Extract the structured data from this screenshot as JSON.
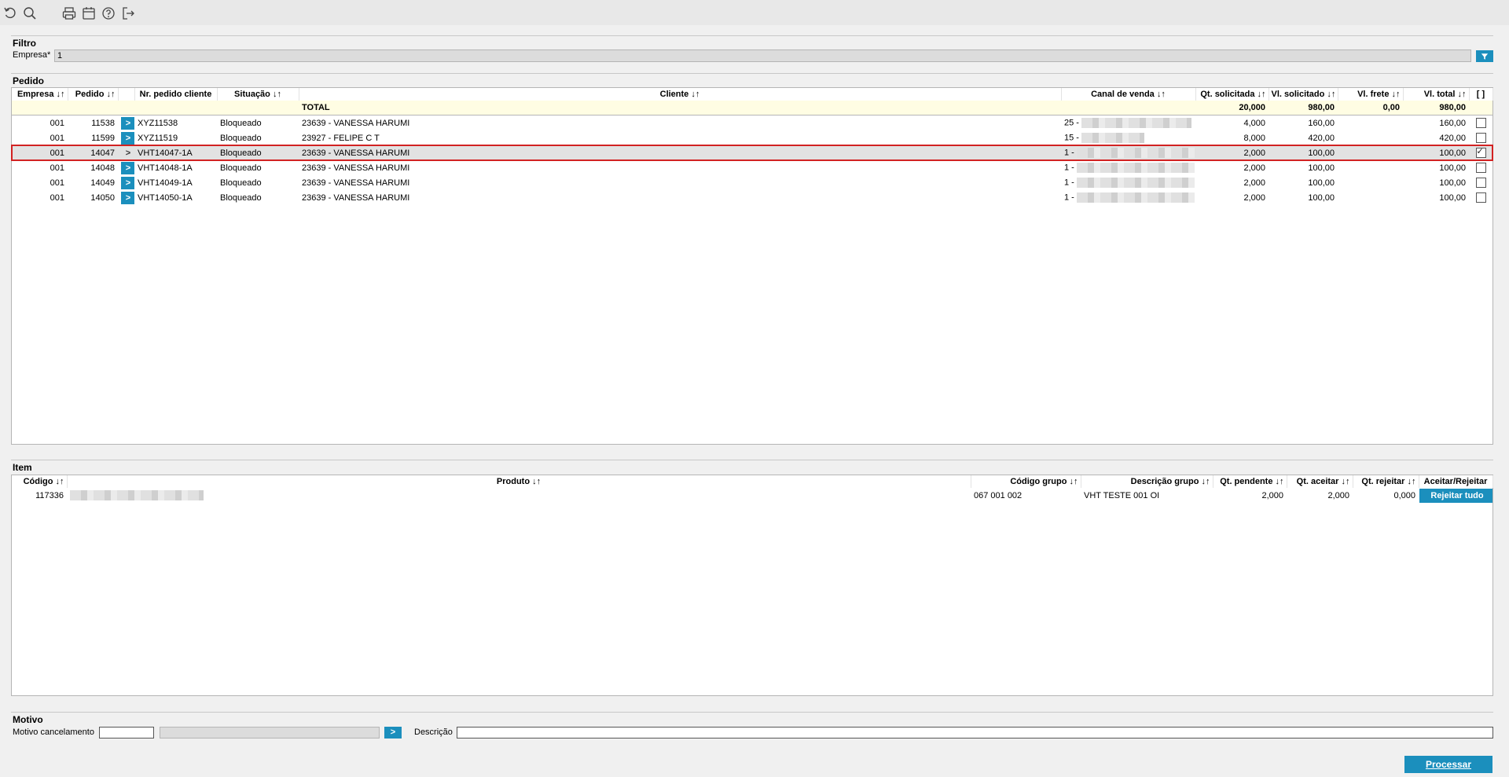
{
  "toolbar": {
    "icons": [
      "refresh-icon",
      "search-icon",
      "print-icon",
      "calendar-icon",
      "help-icon",
      "exit-icon"
    ]
  },
  "filtro": {
    "title": "Filtro",
    "empresa_label": "Empresa*",
    "empresa_value": "1"
  },
  "pedido": {
    "title": "Pedido",
    "headers": {
      "empresa": "Empresa ↓↑",
      "pedido": "Pedido ↓↑",
      "nr_pedido_cliente": "Nr. pedido cliente",
      "situacao": "Situação ↓↑",
      "cliente": "Cliente ↓↑",
      "canal_venda": "Canal de venda ↓↑",
      "qt_solicitada": "Qt. solicitada ↓↑",
      "vl_solicitado": "Vl. solicitado ↓↑",
      "vl_frete": "Vl. frete ↓↑",
      "vl_total": "Vl. total ↓↑",
      "check_all": "[ ]"
    },
    "total": {
      "label": "TOTAL",
      "qt_solicitada": "20,000",
      "vl_solicitado": "980,00",
      "vl_frete": "0,00",
      "vl_total": "980,00"
    },
    "rows": [
      {
        "empresa": "001",
        "pedido": "11538",
        "arrow": ">",
        "nr": "XYZ11538",
        "situacao": "Bloqueado",
        "cliente": "23639 - VANESSA HARUMI",
        "canal": "25 -",
        "qt": "4,000",
        "vl_sol": "160,00",
        "vl_total": "160,00",
        "checked": false
      },
      {
        "empresa": "001",
        "pedido": "11599",
        "arrow": ">",
        "nr": "XYZ11519",
        "situacao": "Bloqueado",
        "cliente": "23927 - FELIPE C T",
        "canal": "15 -",
        "qt": "8,000",
        "vl_sol": "420,00",
        "vl_total": "420,00",
        "checked": false
      },
      {
        "empresa": "001",
        "pedido": "14047",
        "arrow": ">",
        "nr": "VHT14047-1A",
        "situacao": "Bloqueado",
        "cliente": "23639 - VANESSA HARUMI",
        "canal": "1 -",
        "qt": "2,000",
        "vl_sol": "100,00",
        "vl_total": "100,00",
        "checked": true
      },
      {
        "empresa": "001",
        "pedido": "14048",
        "arrow": ">",
        "nr": "VHT14048-1A",
        "situacao": "Bloqueado",
        "cliente": "23639 - VANESSA HARUMI",
        "canal": "1 -",
        "qt": "2,000",
        "vl_sol": "100,00",
        "vl_total": "100,00",
        "checked": false
      },
      {
        "empresa": "001",
        "pedido": "14049",
        "arrow": ">",
        "nr": "VHT14049-1A",
        "situacao": "Bloqueado",
        "cliente": "23639 - VANESSA HARUMI",
        "canal": "1 -",
        "qt": "2,000",
        "vl_sol": "100,00",
        "vl_total": "100,00",
        "checked": false
      },
      {
        "empresa": "001",
        "pedido": "14050",
        "arrow": ">",
        "nr": "VHT14050-1A",
        "situacao": "Bloqueado",
        "cliente": "23639 - VANESSA HARUMI",
        "canal": "1 -",
        "qt": "2,000",
        "vl_sol": "100,00",
        "vl_total": "100,00",
        "checked": false
      }
    ]
  },
  "item": {
    "title": "Item",
    "headers": {
      "codigo": "Código ↓↑",
      "produto": "Produto ↓↑",
      "codigo_grupo": "Código grupo ↓↑",
      "descricao_grupo": "Descrição grupo ↓↑",
      "qt_pendente": "Qt. pendente ↓↑",
      "qt_aceitar": "Qt. aceitar ↓↑",
      "qt_rejeitar": "Qt. rejeitar ↓↑",
      "aceitar_rejeitar": "Aceitar/Rejeitar"
    },
    "rows": [
      {
        "codigo": "117336",
        "codigo_grupo": "067 001 002",
        "descricao_grupo": "VHT TESTE 001 OI",
        "qt_pendente": "2,000",
        "qt_aceitar": "2,000",
        "qt_rejeitar": "0,000",
        "action": "Rejeitar tudo"
      }
    ]
  },
  "motivo": {
    "title": "Motivo",
    "motivo_label": "Motivo cancelamento",
    "descricao_label": "Descrição",
    "arrow": ">"
  },
  "processar_label": "Processar",
  "colors": {
    "accent": "#1b8fbd",
    "selection_outline": "#d22222",
    "total_bg": "#fffde3"
  }
}
